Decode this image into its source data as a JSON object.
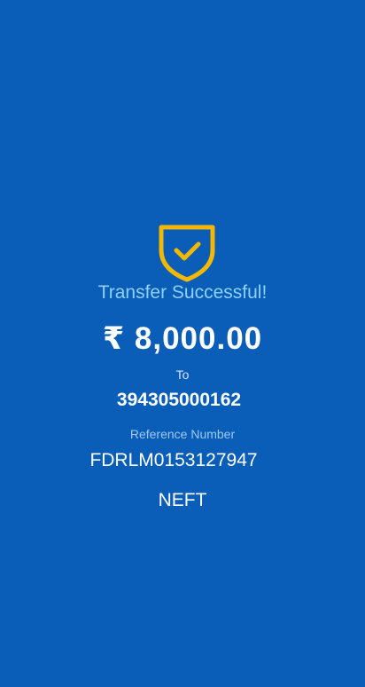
{
  "colors": {
    "background": "#0a5eb8",
    "shield": "#f5b800",
    "status_text": "#8fd0ff",
    "primary_text": "#ffffff"
  },
  "icon": "shield-check-icon",
  "transfer": {
    "status": "Transfer Successful!",
    "amount": "₹ 8,000.00",
    "to_label": "To",
    "to_account": "394305000162",
    "reference_label": "Reference Number",
    "reference_number": "FDRLM0153127947",
    "mode": "NEFT"
  }
}
